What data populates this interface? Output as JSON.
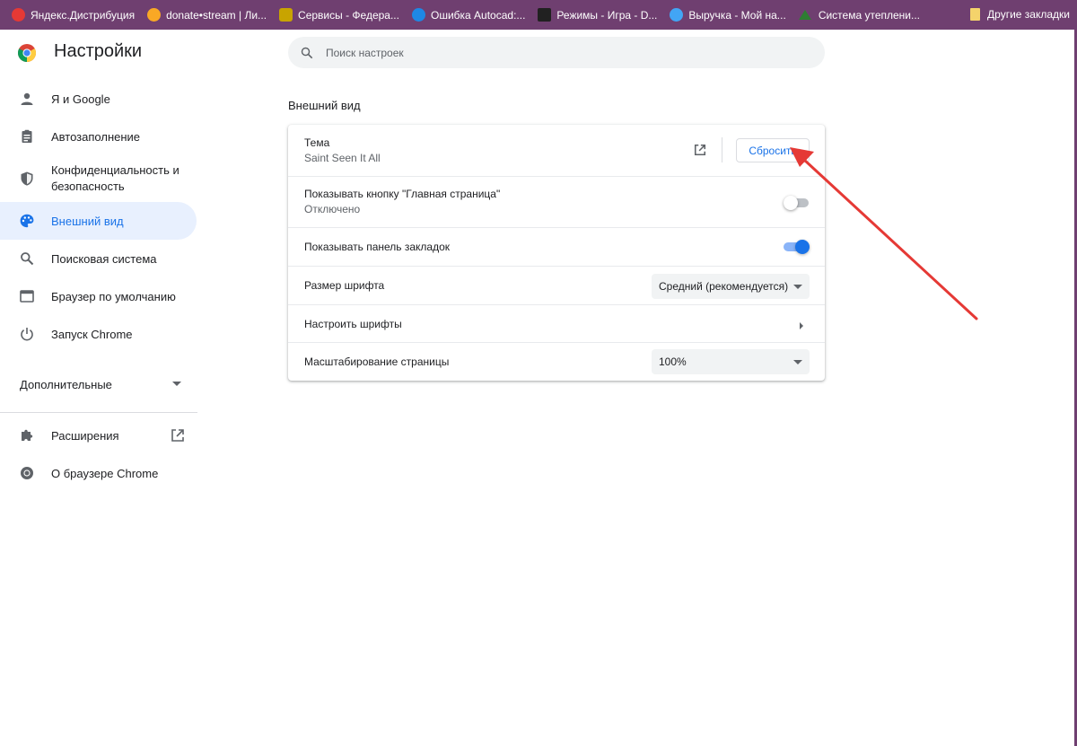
{
  "bookmarks": {
    "items": [
      {
        "label": "Яндекс.Дистрибуция",
        "icon": "yandex-icon",
        "color": "#e53935"
      },
      {
        "label": "donate•stream | Ли...",
        "icon": "donate-stream-icon",
        "color": "#f9a825"
      },
      {
        "label": "Сервисы - Федера...",
        "icon": "emblem-icon",
        "color": "#c8a400"
      },
      {
        "label": "Ошибка Autocad:...",
        "icon": "autocad-icon",
        "color": "#1e88e5"
      },
      {
        "label": "Режимы - Игра - D...",
        "icon": "game-d-icon",
        "color": "#212121"
      },
      {
        "label": "Выручка - Мой на...",
        "icon": "globe-icon",
        "color": "#42a5f5"
      },
      {
        "label": "Система утеплени...",
        "icon": "roof-icon",
        "color": "#2e7d32"
      }
    ],
    "other": "Другие закладки"
  },
  "header": {
    "title": "Настройки"
  },
  "search": {
    "placeholder": "Поиск настроек"
  },
  "sidebar": {
    "items": [
      {
        "label": "Я и Google",
        "icon": "person-icon"
      },
      {
        "label": "Автозаполнение",
        "icon": "clipboard-icon"
      },
      {
        "label": "Конфиденциальность и безопасность",
        "icon": "shield-icon"
      },
      {
        "label": "Внешний вид",
        "icon": "palette-icon",
        "active": true
      },
      {
        "label": "Поисковая система",
        "icon": "search-icon"
      },
      {
        "label": "Браузер по умолчанию",
        "icon": "browser-window-icon"
      },
      {
        "label": "Запуск Chrome",
        "icon": "power-icon"
      }
    ],
    "more": "Дополнительные",
    "extensions": "Расширения",
    "about": "О браузере Chrome"
  },
  "appearance": {
    "section_title": "Внешний вид",
    "theme": {
      "label": "Тема",
      "value": "Saint Seen It All",
      "reset_button": "Сбросить"
    },
    "home_button": {
      "label": "Показывать кнопку \"Главная страница\"",
      "value": "Отключено",
      "enabled": false
    },
    "bookmarks_bar": {
      "label": "Показывать панель закладок",
      "enabled": true
    },
    "font_size": {
      "label": "Размер шрифта",
      "selected": "Средний (рекомендуется)"
    },
    "customize_fonts": {
      "label": "Настроить шрифты"
    },
    "page_zoom": {
      "label": "Масштабирование страницы",
      "selected": "100%"
    }
  },
  "colors": {
    "accent": "#1a73e8",
    "bookmarks_bar_bg": "#6f3f70",
    "annotation_arrow": "#e53935"
  }
}
